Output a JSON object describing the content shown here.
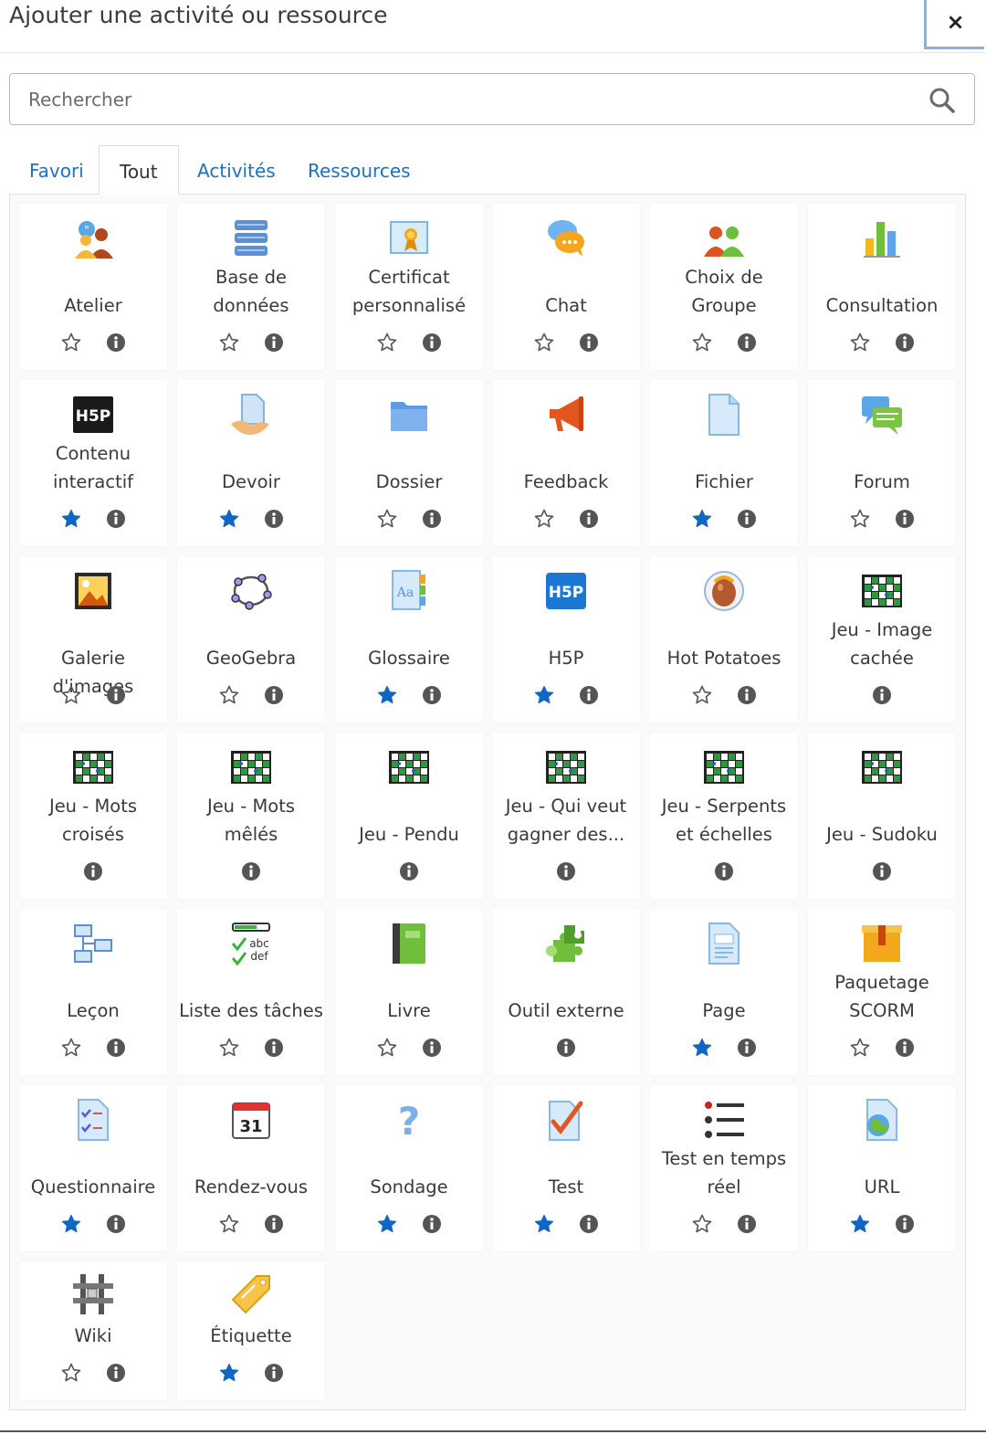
{
  "modal": {
    "title": "Ajouter une activité ou ressource",
    "close_glyph": "×"
  },
  "search": {
    "placeholder": "Rechercher",
    "value": "",
    "icon": "search-icon"
  },
  "tabs": [
    {
      "label": "Favori",
      "active": false
    },
    {
      "label": "Tout",
      "active": true
    },
    {
      "label": "Activités",
      "active": false
    },
    {
      "label": "Ressources",
      "active": false
    }
  ],
  "colors": {
    "accent_blue": "#1a73c2",
    "star_filled": "#1066c2",
    "info_grey": "#555555"
  },
  "modules": [
    {
      "label": "Atelier",
      "icon": "workshop-icon",
      "starred": false,
      "has_star": true
    },
    {
      "label": "Base de\ndonnées",
      "icon": "database-icon",
      "starred": false,
      "has_star": true
    },
    {
      "label": "Certificat\npersonnalisé",
      "icon": "certificate-icon",
      "starred": false,
      "has_star": true
    },
    {
      "label": "Chat",
      "icon": "chat-icon",
      "starred": false,
      "has_star": true
    },
    {
      "label": "Choix de\nGroupe",
      "icon": "group-choice-icon",
      "starred": false,
      "has_star": true
    },
    {
      "label": "Consultation",
      "icon": "consultation-icon",
      "starred": false,
      "has_star": true
    },
    {
      "label": "Contenu\ninteractif",
      "icon": "h5p-dark-icon",
      "starred": true,
      "has_star": true
    },
    {
      "label": "Devoir",
      "icon": "assignment-icon",
      "starred": true,
      "has_star": true
    },
    {
      "label": "Dossier",
      "icon": "folder-icon",
      "starred": false,
      "has_star": true
    },
    {
      "label": "Feedback",
      "icon": "megaphone-icon",
      "starred": false,
      "has_star": true
    },
    {
      "label": "Fichier",
      "icon": "file-icon",
      "starred": true,
      "has_star": true
    },
    {
      "label": "Forum",
      "icon": "forum-icon",
      "starred": false,
      "has_star": true
    },
    {
      "label": "Galerie d'images",
      "icon": "gallery-icon",
      "starred": false,
      "has_star": true
    },
    {
      "label": "GeoGebra",
      "icon": "geogebra-icon",
      "starred": false,
      "has_star": true
    },
    {
      "label": "Glossaire",
      "icon": "glossary-icon",
      "starred": true,
      "has_star": true
    },
    {
      "label": "H5P",
      "icon": "h5p-blue-icon",
      "starred": true,
      "has_star": true
    },
    {
      "label": "Hot Potatoes",
      "icon": "hot-potatoes-icon",
      "starred": false,
      "has_star": true
    },
    {
      "label": "Jeu - Image\ncachée",
      "icon": "game-board-icon",
      "starred": false,
      "has_star": false
    },
    {
      "label": "Jeu - Mots\ncroisés",
      "icon": "game-board-icon",
      "starred": false,
      "has_star": false
    },
    {
      "label": "Jeu - Mots\nmêlés",
      "icon": "game-board-icon",
      "starred": false,
      "has_star": false
    },
    {
      "label": "Jeu - Pendu",
      "icon": "game-board-icon",
      "starred": false,
      "has_star": false
    },
    {
      "label": "Jeu - Qui veut\ngagner des...",
      "icon": "game-board-icon",
      "starred": false,
      "has_star": false
    },
    {
      "label": "Jeu - Serpents\net échelles",
      "icon": "game-board-icon",
      "starred": false,
      "has_star": false
    },
    {
      "label": "Jeu - Sudoku",
      "icon": "game-board-icon",
      "starred": false,
      "has_star": false
    },
    {
      "label": "Leçon",
      "icon": "lesson-icon",
      "starred": false,
      "has_star": true
    },
    {
      "label": "Liste des tâches",
      "icon": "checklist-icon",
      "starred": false,
      "has_star": true
    },
    {
      "label": "Livre",
      "icon": "book-icon",
      "starred": false,
      "has_star": true
    },
    {
      "label": "Outil externe",
      "icon": "puzzle-icon",
      "starred": false,
      "has_star": false
    },
    {
      "label": "Page",
      "icon": "page-icon",
      "starred": true,
      "has_star": true
    },
    {
      "label": "Paquetage\nSCORM",
      "icon": "scorm-package-icon",
      "starred": false,
      "has_star": true
    },
    {
      "label": "Questionnaire",
      "icon": "questionnaire-icon",
      "starred": true,
      "has_star": true
    },
    {
      "label": "Rendez-vous",
      "icon": "calendar-icon",
      "starred": false,
      "has_star": true
    },
    {
      "label": "Sondage",
      "icon": "question-mark-icon",
      "starred": true,
      "has_star": true
    },
    {
      "label": "Test",
      "icon": "quiz-check-icon",
      "starred": true,
      "has_star": true
    },
    {
      "label": "Test en temps\nréel",
      "icon": "list-bullets-icon",
      "starred": false,
      "has_star": true
    },
    {
      "label": "URL",
      "icon": "url-globe-icon",
      "starred": true,
      "has_star": true
    },
    {
      "label": "Wiki",
      "icon": "wiki-icon",
      "starred": false,
      "has_star": true
    },
    {
      "label": "Étiquette",
      "icon": "label-tag-icon",
      "starred": true,
      "has_star": true
    }
  ],
  "calendar_day": "31"
}
